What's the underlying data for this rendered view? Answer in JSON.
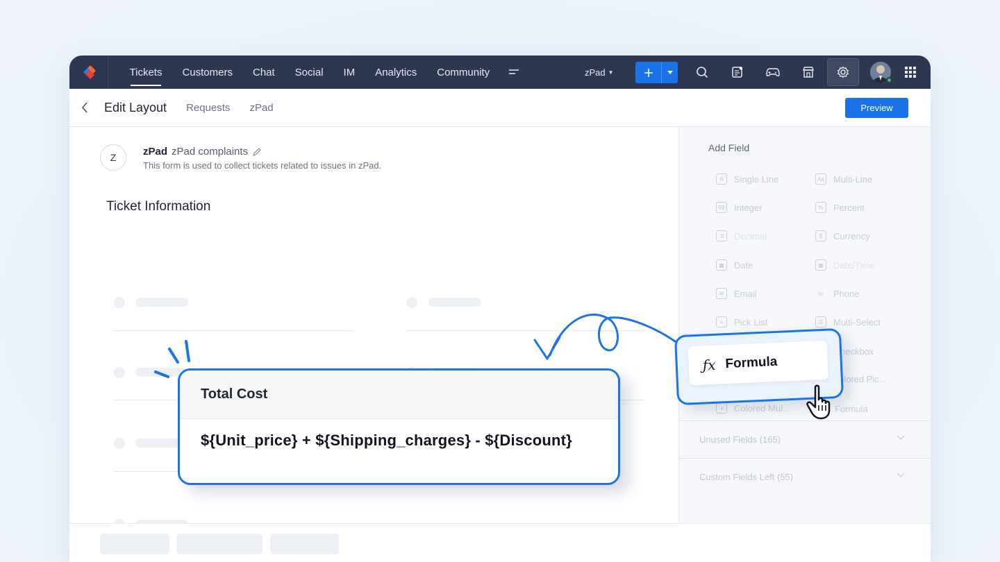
{
  "nav": {
    "tabs": [
      "Tickets",
      "Customers",
      "Chat",
      "Social",
      "IM",
      "Analytics",
      "Community"
    ],
    "department": "zPad",
    "icons": [
      "search-icon",
      "notes-icon",
      "gamepad-icon",
      "store-icon",
      "settings-icon",
      "apps-grid-icon"
    ]
  },
  "subheader": {
    "title": "Edit Layout",
    "crumbs": [
      "Requests",
      "zPad"
    ],
    "preview_label": "Preview"
  },
  "form": {
    "avatar_letter": "Z",
    "name": "zPad",
    "layout_name": "zPad complaints",
    "description": "This form is used to collect tickets related to issues in zPad.",
    "section_title": "Ticket Information"
  },
  "side": {
    "title": "Add Field",
    "fields": [
      {
        "label": "Single Line",
        "icon": "A"
      },
      {
        "label": "Multi-Line",
        "icon": "Aa"
      },
      {
        "label": "Integer",
        "icon": "99"
      },
      {
        "label": "Percent",
        "icon": "%"
      },
      {
        "label": "Decimal",
        "icon": ".0"
      },
      {
        "label": "Currency",
        "icon": "$"
      },
      {
        "label": "Date",
        "icon": "▦"
      },
      {
        "label": "Date/Time",
        "icon": "▦"
      },
      {
        "label": "Email",
        "icon": "✉"
      },
      {
        "label": "Phone",
        "icon": "☏"
      },
      {
        "label": "Pick List",
        "icon": "≡"
      },
      {
        "label": "Multi-Select",
        "icon": "☰"
      },
      {
        "label": "Checkbox",
        "icon": "✓"
      },
      {
        "label": "Colored Pic...",
        "icon": "◐"
      },
      {
        "label": "Colored Mul...",
        "icon": "◑"
      },
      {
        "label": "Formula",
        "icon": "ƒ"
      }
    ],
    "partial_labels": {
      "checkbox": "heckbox",
      "colored_pick": "olored Pic...",
      "formula": "Formula"
    },
    "unused_fields": "Unused Fields (165)",
    "custom_fields_left": "Custom Fields Left (55)"
  },
  "cost_card": {
    "title": "Total Cost",
    "expression": "${Unit_price} + ${Shipping_charges} - ${Discount}"
  },
  "formula_card": {
    "fx": "ƒx",
    "label": "Formula"
  },
  "colors": {
    "nav_bg": "#2d3752",
    "accent": "#1a73e8",
    "panel_bg": "#f5f7fa"
  }
}
